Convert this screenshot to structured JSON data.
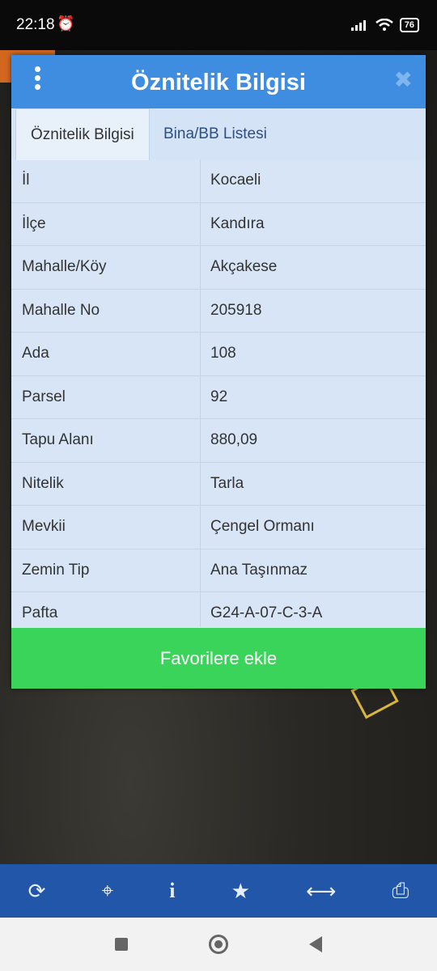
{
  "status_bar": {
    "time": "22:18",
    "battery": "76"
  },
  "dialog": {
    "title": "Öznitelik Bilgisi",
    "tabs": [
      {
        "label": "Öznitelik Bilgisi",
        "active": true
      },
      {
        "label": "Bina/BB Listesi",
        "active": false
      }
    ],
    "rows": [
      {
        "key": "İl",
        "value": "Kocaeli"
      },
      {
        "key": "İlçe",
        "value": "Kandıra"
      },
      {
        "key": "Mahalle/Köy",
        "value": "Akçakese"
      },
      {
        "key": "Mahalle No",
        "value": "205918"
      },
      {
        "key": "Ada",
        "value": "108"
      },
      {
        "key": "Parsel",
        "value": "92"
      },
      {
        "key": "Tapu Alanı",
        "value": "880,09"
      },
      {
        "key": "Nitelik",
        "value": "Tarla"
      },
      {
        "key": "Mevkii",
        "value": "Çengel Ormanı"
      },
      {
        "key": "Zemin Tip",
        "value": "Ana Taşınmaz"
      },
      {
        "key": "Pafta",
        "value": "G24-A-07-C-3-A"
      }
    ],
    "favorite_button": "Favorilere ekle"
  },
  "toolbar": {
    "icons": [
      "refresh-icon",
      "locate-icon",
      "info-icon",
      "star-icon",
      "measure-icon",
      "print-icon"
    ]
  },
  "colors": {
    "header": "#3f8de0",
    "favorite": "#3bd45a",
    "toolbar": "#2256a8"
  }
}
